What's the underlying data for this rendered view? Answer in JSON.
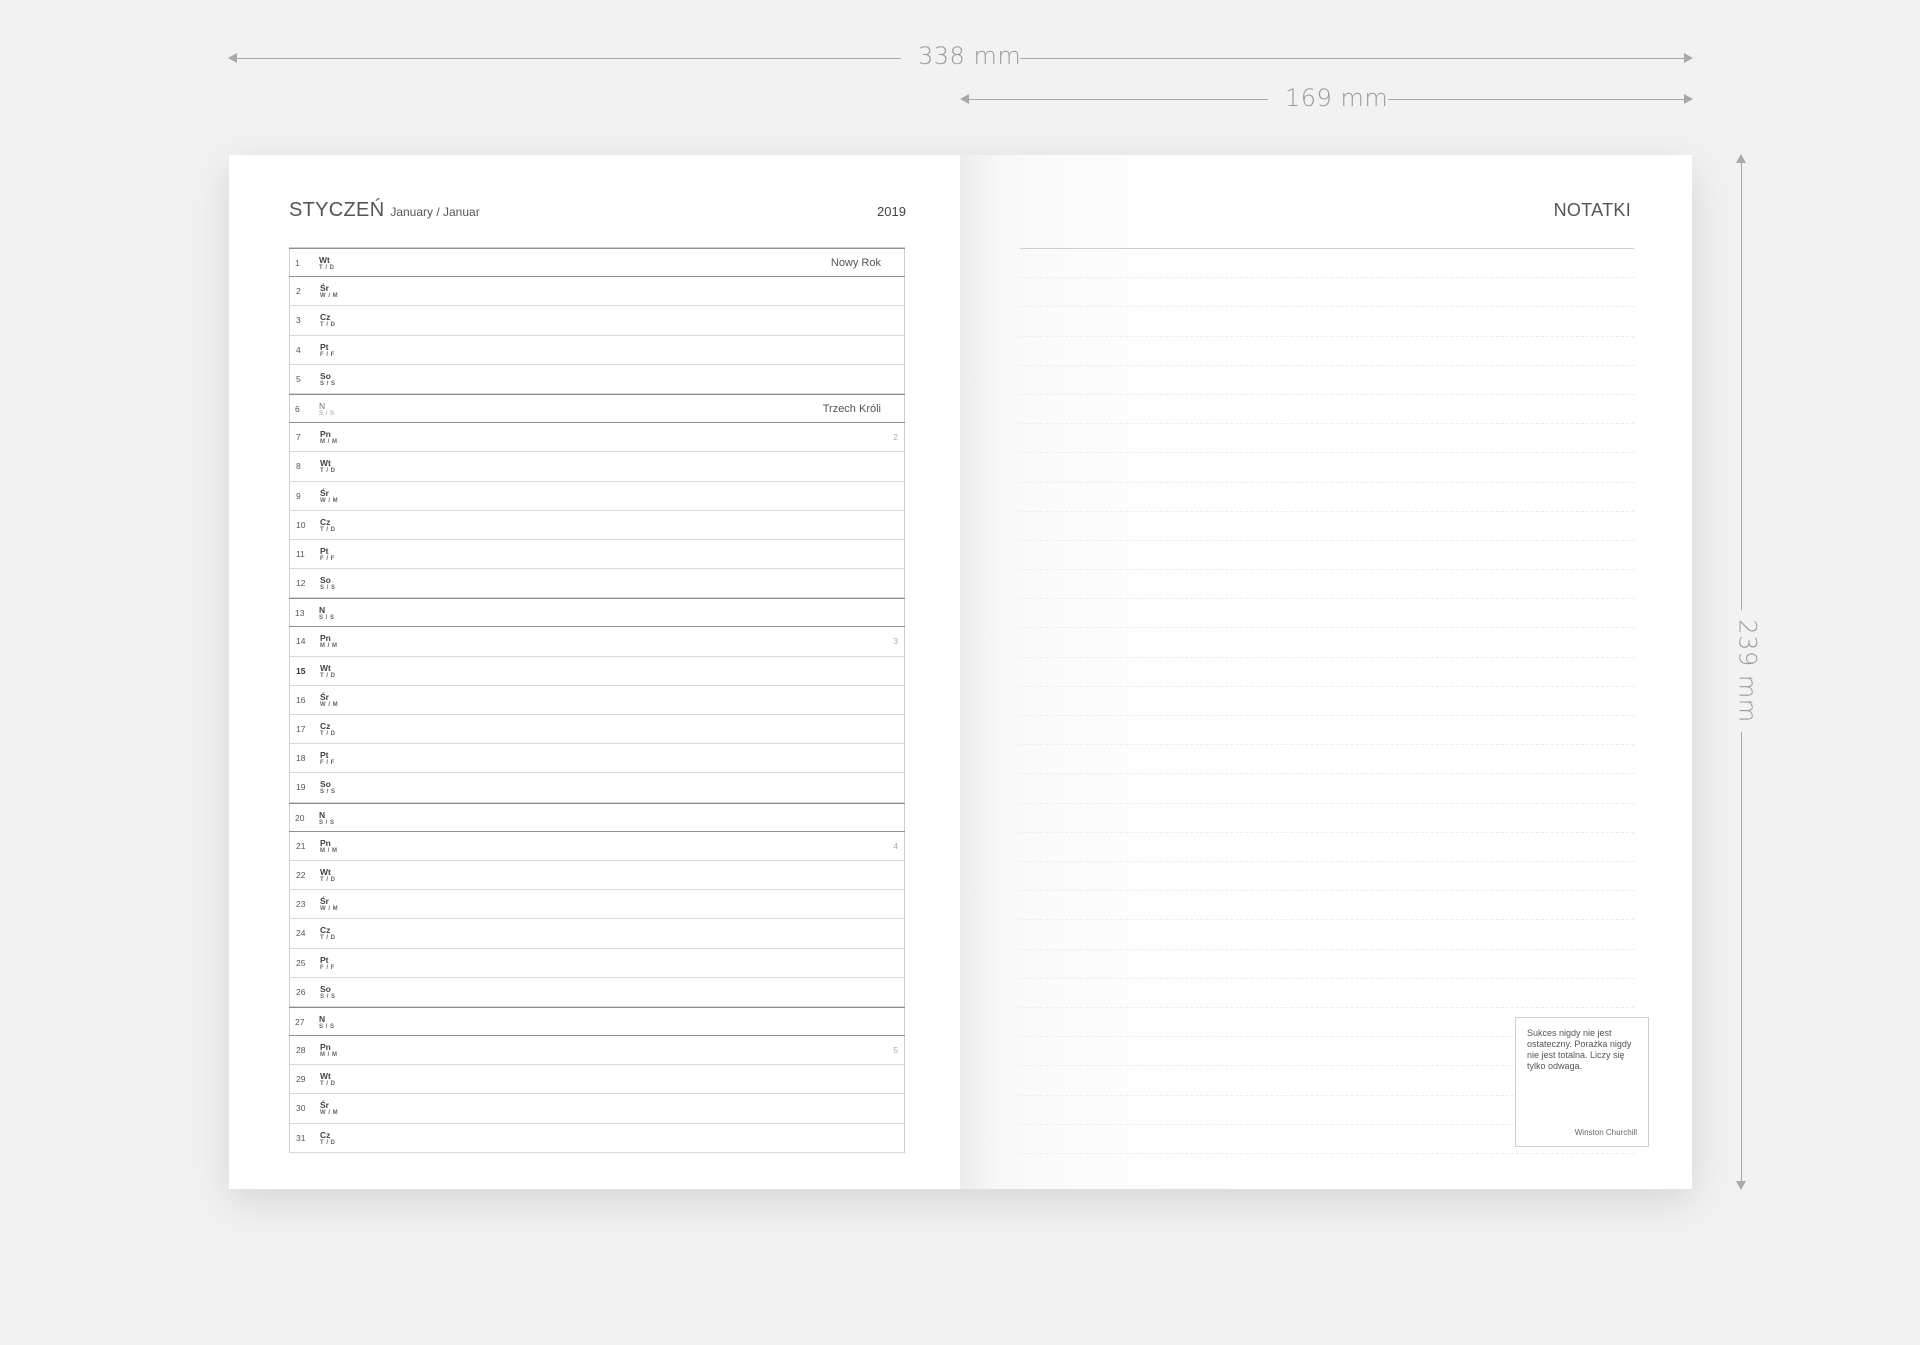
{
  "dimensions": {
    "width_label": "338 mm",
    "half_width_label": "169 mm",
    "height_label": "239 mm"
  },
  "left_page": {
    "month": "STYCZEŃ",
    "month_sub": "January / Januar",
    "year": "2019",
    "days": [
      {
        "num": "1",
        "d1": "Wt",
        "d2": "T / D",
        "holiday": "Nowy Rok",
        "highlight": true
      },
      {
        "num": "2",
        "d1": "Śr",
        "d2": "W / M"
      },
      {
        "num": "3",
        "d1": "Cz",
        "d2": "T / D"
      },
      {
        "num": "4",
        "d1": "Pt",
        "d2": "F / F"
      },
      {
        "num": "5",
        "d1": "So",
        "d2": "S / S"
      },
      {
        "num": "6",
        "d1": "N",
        "d2": "S / S",
        "holiday": "Trzech Króli",
        "highlight": true,
        "light": true
      },
      {
        "num": "7",
        "d1": "Pn",
        "d2": "M / M",
        "week": "2"
      },
      {
        "num": "8",
        "d1": "Wt",
        "d2": "T / D"
      },
      {
        "num": "9",
        "d1": "Śr",
        "d2": "W / M"
      },
      {
        "num": "10",
        "d1": "Cz",
        "d2": "T / D"
      },
      {
        "num": "11",
        "d1": "Pt",
        "d2": "F / F"
      },
      {
        "num": "12",
        "d1": "So",
        "d2": "S / S"
      },
      {
        "num": "13",
        "d1": "N",
        "d2": "S / S",
        "highlight": true
      },
      {
        "num": "14",
        "d1": "Pn",
        "d2": "M / M",
        "week": "3"
      },
      {
        "num": "15",
        "d1": "Wt",
        "d2": "T / D",
        "bold": true
      },
      {
        "num": "16",
        "d1": "Śr",
        "d2": "W / M"
      },
      {
        "num": "17",
        "d1": "Cz",
        "d2": "T / D"
      },
      {
        "num": "18",
        "d1": "Pt",
        "d2": "F / F"
      },
      {
        "num": "19",
        "d1": "So",
        "d2": "S / S"
      },
      {
        "num": "20",
        "d1": "N",
        "d2": "S / S",
        "highlight": true
      },
      {
        "num": "21",
        "d1": "Pn",
        "d2": "M / M",
        "week": "4"
      },
      {
        "num": "22",
        "d1": "Wt",
        "d2": "T / D"
      },
      {
        "num": "23",
        "d1": "Śr",
        "d2": "W / M"
      },
      {
        "num": "24",
        "d1": "Cz",
        "d2": "T / D"
      },
      {
        "num": "25",
        "d1": "Pt",
        "d2": "F / F"
      },
      {
        "num": "26",
        "d1": "So",
        "d2": "S / S"
      },
      {
        "num": "27",
        "d1": "N",
        "d2": "S / S",
        "highlight": true
      },
      {
        "num": "28",
        "d1": "Pn",
        "d2": "M / M",
        "week": "5"
      },
      {
        "num": "29",
        "d1": "Wt",
        "d2": "T / D"
      },
      {
        "num": "30",
        "d1": "Śr",
        "d2": "W / M"
      },
      {
        "num": "31",
        "d1": "Cz",
        "d2": "T / D"
      }
    ]
  },
  "right_page": {
    "title": "NOTATKI",
    "quote": {
      "text": "Sukces nigdy nie jest ostateczny. Porażka nigdy nie jest totalna. Liczy się tylko odwaga.",
      "author": "Winston Churchill"
    }
  }
}
